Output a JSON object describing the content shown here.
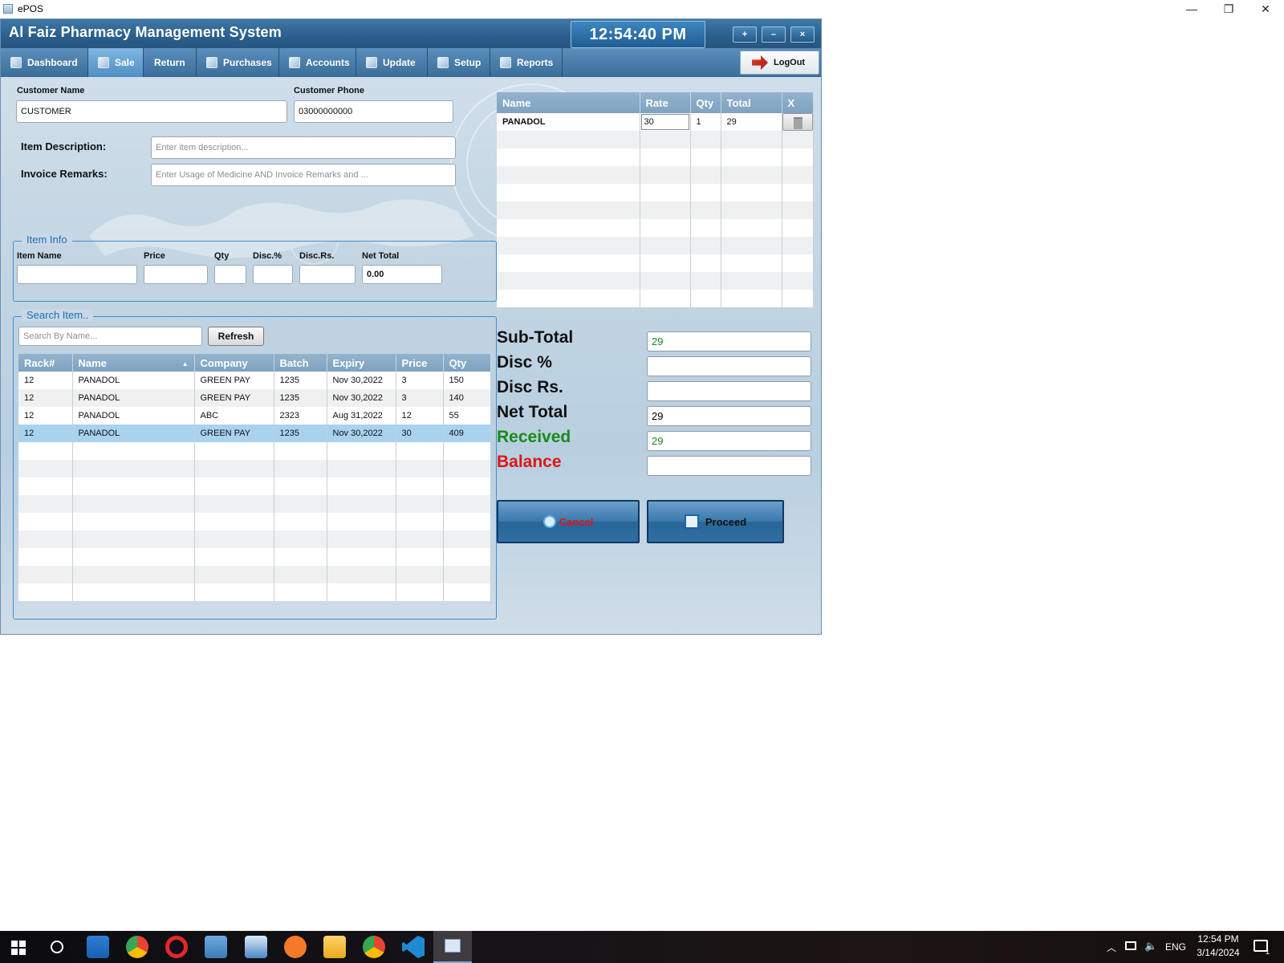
{
  "window": {
    "title": "ePOS",
    "min": "—",
    "max": "❐",
    "close": "✕"
  },
  "app": {
    "title": "Al Faiz Pharmacy Management System",
    "clock": "12:54:40 PM",
    "window_buttons": [
      "+",
      "–",
      "×"
    ]
  },
  "tabs": [
    {
      "label": "Dashboard"
    },
    {
      "label": "Sale",
      "active": true
    },
    {
      "label": "Return"
    },
    {
      "label": "Purchases"
    },
    {
      "label": "Accounts"
    },
    {
      "label": "Update"
    },
    {
      "label": "Setup"
    },
    {
      "label": "Reports"
    }
  ],
  "logout_label": "LogOut",
  "customer": {
    "name_label": "Customer Name",
    "name_value": "CUSTOMER",
    "phone_label": "Customer Phone",
    "phone_value": "03000000000"
  },
  "item_description": {
    "label": "Item Description:",
    "placeholder": "Enter item description..."
  },
  "invoice_remarks": {
    "label": "Invoice Remarks:",
    "placeholder": "Enter Usage of Medicine AND Invoice Remarks and ..."
  },
  "item_info": {
    "legend": "Item Info",
    "labels": {
      "item_name": "Item Name",
      "price": "Price",
      "qty": "Qty",
      "disc_pct": "Disc.%",
      "disc_rs": "Disc.Rs.",
      "net_total": "Net Total"
    },
    "net_total_value": "0.00"
  },
  "search": {
    "legend": "Search Item..",
    "placeholder": "Search By Name...",
    "refresh_label": "Refresh",
    "columns": [
      "Rack#",
      "Name",
      "Company",
      "Batch",
      "Expiry",
      "Price",
      "Qty"
    ],
    "rows": [
      [
        "12",
        "PANADOL",
        "GREEN PAY",
        "1235",
        "Nov 30,2022",
        "3",
        "150"
      ],
      [
        "12",
        "PANADOL",
        "GREEN PAY",
        "1235",
        "Nov 30,2022",
        "3",
        "140"
      ],
      [
        "12",
        "PANADOL",
        "ABC",
        "2323",
        "Aug 31,2022",
        "12",
        "55"
      ],
      [
        "12",
        "PANADOL",
        "GREEN PAY",
        "1235",
        "Nov 30,2022",
        "30",
        "409"
      ]
    ],
    "selected_row": 3
  },
  "cart": {
    "columns": [
      "Name",
      "Rate",
      "Qty",
      "Total",
      "X"
    ],
    "rows": [
      {
        "name": "PANADOL",
        "rate": "30",
        "qty": "1",
        "total": "29"
      }
    ]
  },
  "summary": {
    "subtotal_label": "Sub-Total",
    "subtotal_value": "29",
    "disc_pct_label": "Disc %",
    "disc_pct_value": "",
    "disc_rs_label": "Disc Rs.",
    "disc_rs_value": "",
    "net_total_label": "Net Total",
    "net_total_value": "29",
    "received_label": "Received",
    "received_value": "29",
    "balance_label": "Balance",
    "balance_value": ""
  },
  "actions": {
    "cancel_label": "Cancel",
    "proceed_label": "Proceed"
  },
  "colors": {
    "green": "#1a8a1a",
    "red": "#e01515",
    "header_blue": "#2b5e8c"
  },
  "taskbar": {
    "apps": [
      "start-icon",
      "search-icon",
      "file-manager-icon",
      "chrome-icon",
      "opera-icon",
      "network-app-icon",
      "laptop-app-icon",
      "sublime-icon",
      "folder-icon",
      "chrome-profile-icon",
      "vscode-icon",
      "epos-icon"
    ],
    "language": "ENG",
    "time": "12:54 PM",
    "date": "3/14/2024",
    "notifications": "1"
  }
}
